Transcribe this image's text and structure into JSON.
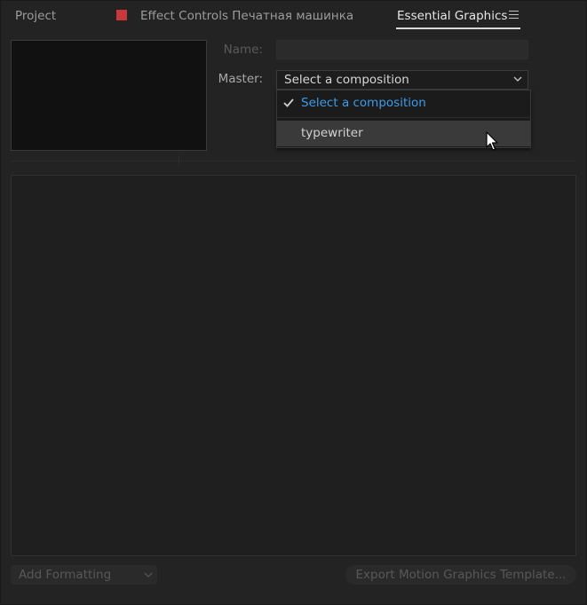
{
  "tabs": {
    "project": "Project",
    "effect_controls": "Effect Controls Печатная машинка",
    "essential_graphics": "Essential Graphics"
  },
  "form": {
    "name_label": "Name:",
    "name_value": "",
    "master_label": "Master:",
    "master_selected": "Select a composition"
  },
  "dropdown": {
    "items": [
      {
        "label": "Select a composition",
        "checked": true
      },
      {
        "label": "typewriter",
        "checked": false,
        "hovered": true
      }
    ]
  },
  "bottom": {
    "add_formatting": "Add Formatting",
    "export_button": "Export Motion Graphics Template..."
  },
  "colors": {
    "accent_blue": "#3d9be9",
    "effect_swatch": "#c8373b",
    "panel_bg": "#232323"
  },
  "icons": {
    "menu": "hamburger-menu-icon",
    "check": "check-icon",
    "chevron": "chevron-down-icon",
    "cursor": "mouse-pointer-icon"
  }
}
